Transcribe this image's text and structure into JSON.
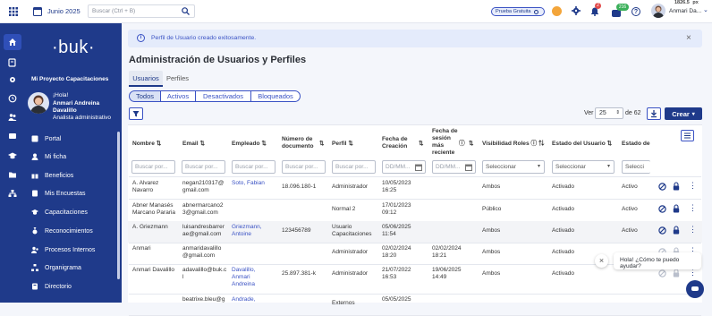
{
  "topbar": {
    "month": "Junio 2025",
    "search_placeholder": "Buscar (Ctrl + B)",
    "trial_badge": "Prueba Gratuita",
    "notif_count": "2",
    "points_badge": "216",
    "user_short": "Anmari Da...",
    "screen_size": "1826.5",
    "screen_unit": "px"
  },
  "sidebar": {
    "logo": "·buk·",
    "project": "Mi Proyecto Capacitaciones",
    "greeting": "¡Hola!",
    "user_name_1": "Anmari Andreina",
    "user_name_2": "Davalillo",
    "user_role": "Analista administrativo",
    "items": [
      {
        "label": "Portal"
      },
      {
        "label": "Mi ficha"
      },
      {
        "label": "Beneficios"
      },
      {
        "label": "Mis Encuestas"
      },
      {
        "label": "Capacitaciones"
      },
      {
        "label": "Reconocimientos"
      },
      {
        "label": "Procesos Internos"
      },
      {
        "label": "Organigrama"
      },
      {
        "label": "Directorio"
      }
    ]
  },
  "alert": {
    "message": "Perfil de Usuario creado exitosamente."
  },
  "page": {
    "title": "Administración de Usuarios y Perfiles",
    "tabs": [
      "Usuarios",
      "Perfiles"
    ],
    "filters": [
      "Todos",
      "Activos",
      "Desactivados",
      "Bloqueados"
    ],
    "ver_label": "Ver",
    "per_page": "25",
    "of_label": "de 62",
    "create_label": "Crear"
  },
  "table": {
    "headers": {
      "nombre": "Nombre",
      "email": "Email",
      "empleado": "Empleado",
      "documento": [
        "Número de",
        "documento"
      ],
      "perfil": "Perfil",
      "fecha_creacion": [
        "Fecha de",
        "Creación"
      ],
      "fecha_sesion": [
        "Fecha de",
        "sesión",
        "más",
        "reciente"
      ],
      "visibilidad": "Visibilidad Roles",
      "estado_usuario": "Estado del Usuario",
      "estado_otro": "Estado de"
    },
    "filters": {
      "buscar": "Buscar por...",
      "date": "DD/MM...",
      "select": "Seleccionar",
      "select_cut": "Selecci"
    },
    "rows": [
      {
        "nombre": [
          "A. Alvarez",
          "Navarro"
        ],
        "email": [
          "negan210317@",
          "gmail.com"
        ],
        "empleado": [
          "Soto, Fabian"
        ],
        "documento": "18.096.180-1",
        "perfil": [
          "Administrador"
        ],
        "fecha": [
          "10/05/2023",
          "16:25"
        ],
        "sesion": [
          "",
          ""
        ],
        "visibilidad": "Ambos",
        "estado": "Activado",
        "estado2": "Activo"
      },
      {
        "nombre": [
          "Abner Manasés",
          "Marcano Pararia"
        ],
        "email": [
          "abnermarcano2",
          "3@gmail.com"
        ],
        "empleado": [
          ""
        ],
        "documento": "",
        "perfil": [
          "Normal 2"
        ],
        "fecha": [
          "17/01/2023",
          "09:12"
        ],
        "sesion": [
          "",
          ""
        ],
        "visibilidad": "Público",
        "estado": "Activado",
        "estado2": "Activo"
      },
      {
        "nombre": [
          "A. Griezmann"
        ],
        "email": [
          "luisandresbarrer",
          "ae@gmail.com"
        ],
        "empleado": [
          "Griezmann,",
          "Antoine"
        ],
        "documento": "123456789",
        "perfil": [
          "Usuario",
          "Capacitaciones"
        ],
        "fecha": [
          "05/06/2025",
          "11:54"
        ],
        "sesion": [
          "",
          ""
        ],
        "visibilidad": "Ambos",
        "estado": "Activado",
        "estado2": "Activo"
      },
      {
        "nombre": [
          "Anmari"
        ],
        "email": [
          "anmaridavalillo",
          "@gmail.com"
        ],
        "empleado": [
          ""
        ],
        "documento": "",
        "perfil": [
          "Administrador"
        ],
        "fecha": [
          "02/02/2024",
          "18:20"
        ],
        "sesion": [
          "02/02/2024",
          "18:21"
        ],
        "visibilidad": "Ambos",
        "estado": "Activado",
        "estado2": ""
      },
      {
        "nombre": [
          "Anmari Davalillo"
        ],
        "email": [
          "adavalillo@buk.c",
          "l"
        ],
        "empleado": [
          "Davalillo,",
          "Anmari",
          "Andreina"
        ],
        "documento": "25.897.381-k",
        "perfil": [
          "Administrador"
        ],
        "fecha": [
          "21/07/2022",
          "16:53"
        ],
        "sesion": [
          "19/06/2025",
          "14:49"
        ],
        "visibilidad": "Ambos",
        "estado": "Activado",
        "estado2": ""
      },
      {
        "nombre": [
          ""
        ],
        "email": [
          "beatrixe.bleu@g"
        ],
        "empleado": [
          "Andrade,"
        ],
        "documento": "",
        "perfil": [
          "Externos"
        ],
        "fecha": [
          "05/05/2025"
        ],
        "sesion": [
          ""
        ],
        "visibilidad": "",
        "estado": "",
        "estado2": ""
      }
    ]
  },
  "chat": {
    "message": "Hola! ¿Cómo te puedo ayudar?"
  },
  "colors": {
    "primary": "#1f3a8a",
    "accent": "#3a52c4",
    "alert_bg": "#e4ebfb"
  }
}
